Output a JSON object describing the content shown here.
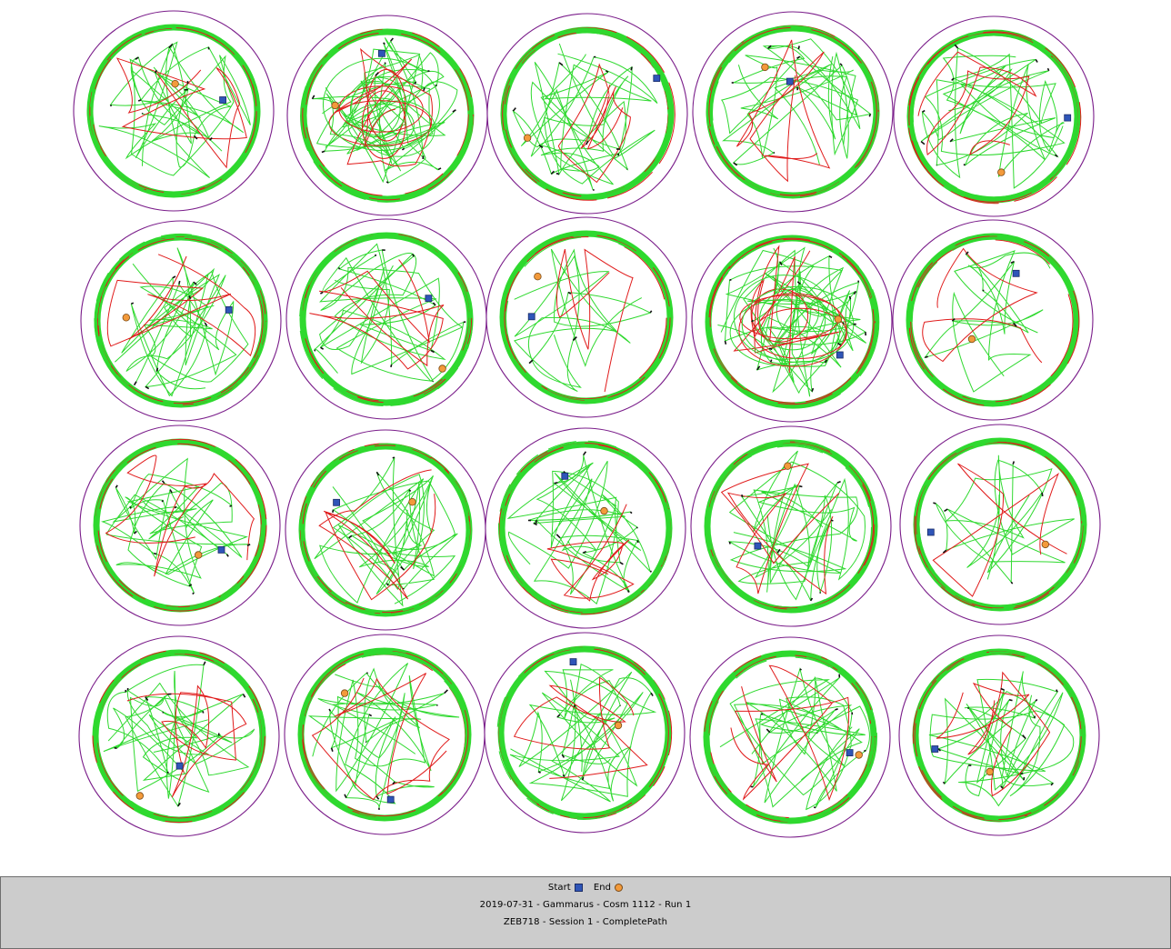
{
  "colors": {
    "arena_outline": "#7a1d8a",
    "path_main": "#2fd92f",
    "path_alt": "#e01b1b",
    "path_stop": "#111111",
    "start_marker": "#2f55b8",
    "end_marker": "#f39a3b",
    "footer_bg": "#cccccc"
  },
  "legend": {
    "start_label": "Start",
    "end_label": "End",
    "start_icon": "blue-square-icon",
    "end_icon": "orange-circle-icon"
  },
  "footer": {
    "title": "2019-07-31 - Gammarus - Cosm 1112 - Run 1",
    "subtitle": "ZEB718 - Session 1 - CompletePath"
  },
  "arenas": [
    {
      "id": "r1c1",
      "pattern": "random",
      "density": "medium"
    },
    {
      "id": "r1c2",
      "pattern": "spiral",
      "density": "high"
    },
    {
      "id": "r1c3",
      "pattern": "random",
      "density": "medium"
    },
    {
      "id": "r1c4",
      "pattern": "random",
      "density": "medium"
    },
    {
      "id": "r1c5",
      "pattern": "random",
      "density": "medium"
    },
    {
      "id": "r2c1",
      "pattern": "random",
      "density": "medium"
    },
    {
      "id": "r2c2",
      "pattern": "random",
      "density": "medium"
    },
    {
      "id": "r2c3",
      "pattern": "sparse",
      "density": "low"
    },
    {
      "id": "r2c4",
      "pattern": "spiral",
      "density": "high"
    },
    {
      "id": "r2c5",
      "pattern": "sparse",
      "density": "low"
    },
    {
      "id": "r3c1",
      "pattern": "random",
      "density": "medium"
    },
    {
      "id": "r3c2",
      "pattern": "random",
      "density": "medium"
    },
    {
      "id": "r3c3",
      "pattern": "random",
      "density": "medium"
    },
    {
      "id": "r3c4",
      "pattern": "random",
      "density": "medium"
    },
    {
      "id": "r3c5",
      "pattern": "sparse",
      "density": "low"
    },
    {
      "id": "r4c1",
      "pattern": "random",
      "density": "medium"
    },
    {
      "id": "r4c2",
      "pattern": "random",
      "density": "medium"
    },
    {
      "id": "r4c3",
      "pattern": "random",
      "density": "medium"
    },
    {
      "id": "r4c4",
      "pattern": "random",
      "density": "medium"
    },
    {
      "id": "r4c5",
      "pattern": "random",
      "density": "medium"
    }
  ]
}
